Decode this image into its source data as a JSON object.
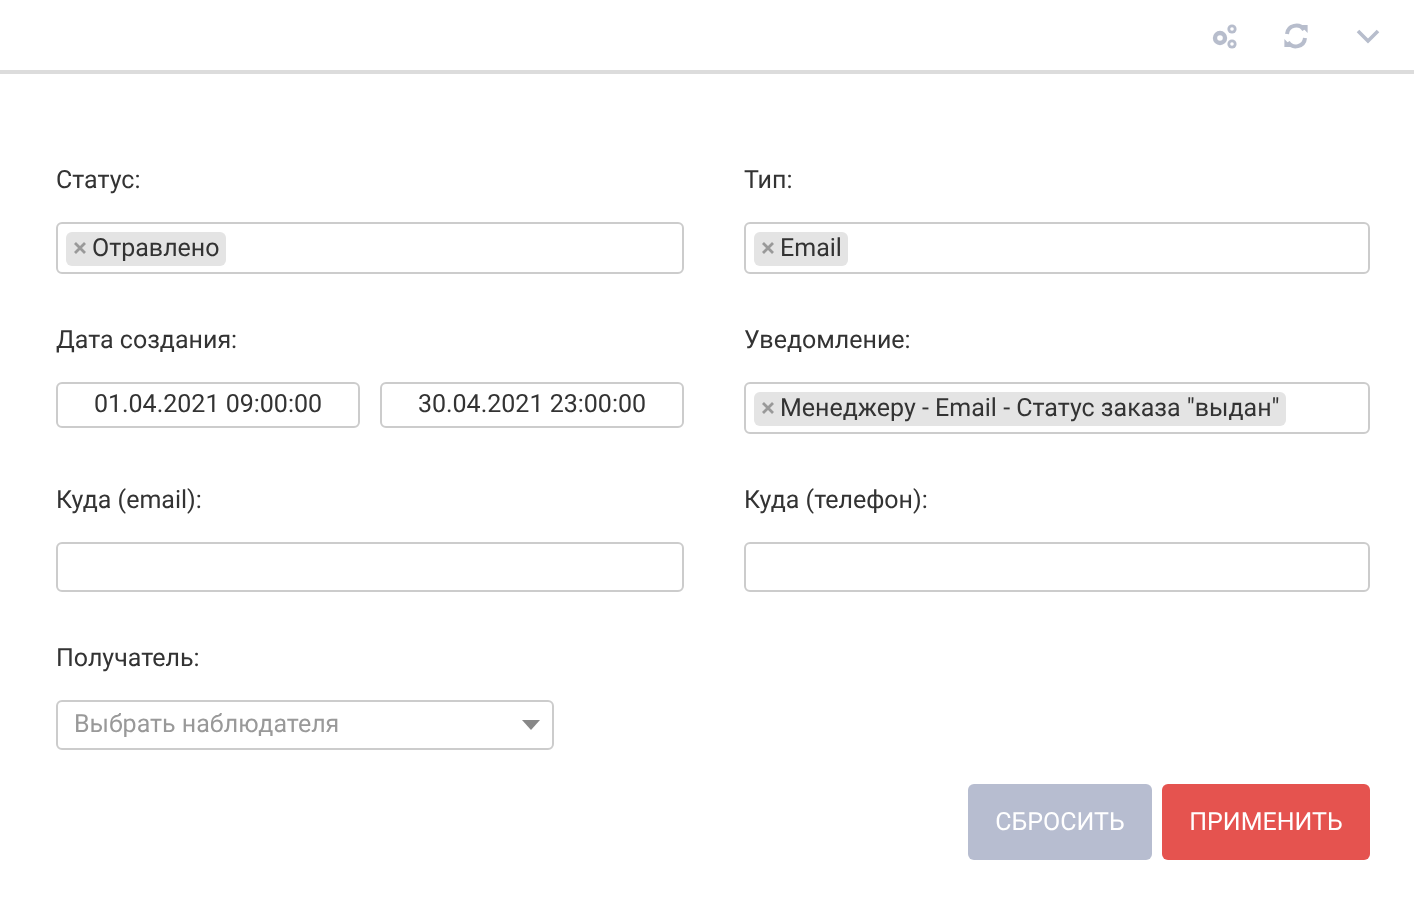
{
  "fields": [
    {
      "label": "Статус:",
      "kind": "tags",
      "tags": [
        "Отравлено"
      ]
    },
    {
      "label": "Тип:",
      "kind": "tags",
      "tags": [
        "Email"
      ]
    },
    {
      "label": "Дата создания:",
      "kind": "daterange",
      "values": [
        "01.04.2021 09:00:00",
        "30.04.2021 23:00:00"
      ]
    },
    {
      "label": "Уведомление:",
      "kind": "tags",
      "tags": [
        "Менеджеру - Email - Статус заказа \"выдан\""
      ]
    },
    {
      "label": "Куда (email):",
      "kind": "text"
    },
    {
      "label": "Куда (телефон):",
      "kind": "text"
    },
    {
      "label": "Получатель:",
      "kind": "select",
      "placeholder": "Выбрать наблюдателя"
    }
  ],
  "buttons": [
    {
      "label": "СБРОСИТЬ",
      "kind": "secondary"
    },
    {
      "label": "ПРИМЕНИТЬ",
      "kind": "primary"
    }
  ]
}
